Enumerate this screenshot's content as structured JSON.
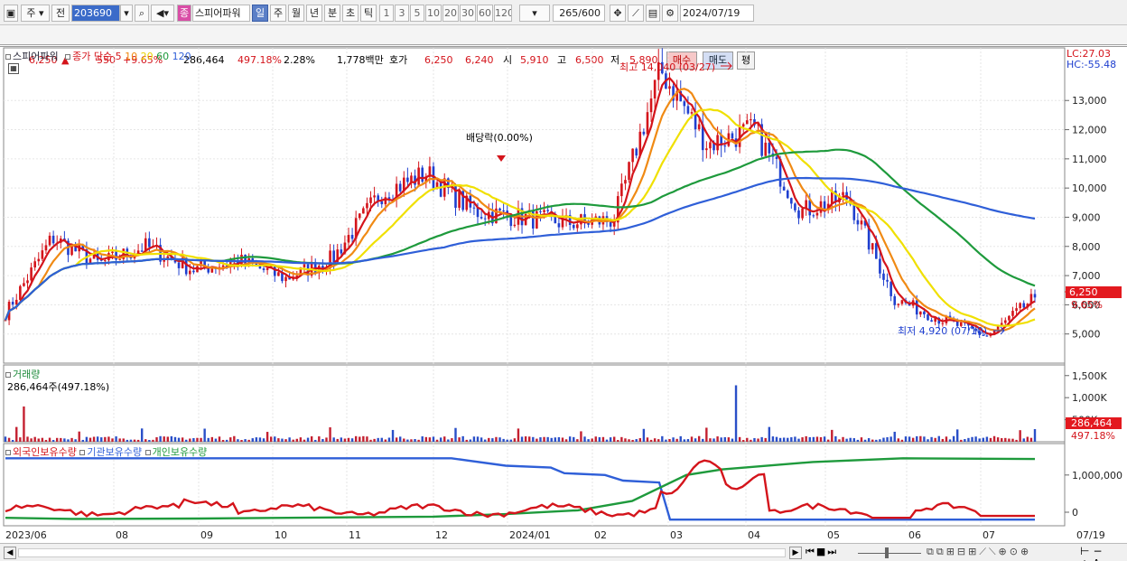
{
  "toolbar": {
    "type_label": "주",
    "prev_label": "전",
    "code": "203690",
    "name_badge": "종",
    "name": "스피어파워",
    "periods": [
      "일",
      "주",
      "월",
      "년",
      "분",
      "초",
      "틱"
    ],
    "intervals": [
      "1",
      "3",
      "5",
      "10",
      "20",
      "30",
      "60",
      "120"
    ],
    "bar_count": "265",
    "bar_total": "/600",
    "date": "2024/07/19"
  },
  "quote": {
    "price": "6,250",
    "arrow": "▲",
    "change": "550",
    "change_pct": "+9.65%",
    "volume": "286,464",
    "volume_pct": "497.18%",
    "turnover_pct": "2.28%",
    "amount": "1,778백만",
    "hoga_label": "호가",
    "ask": "6,250",
    "bid": "6,240",
    "open_label": "시",
    "open": "5,910",
    "high_label": "고",
    "high": "6,500",
    "low_label": "저",
    "low": "5,890",
    "buy_label": "매수",
    "sell_label": "매도",
    "avg_label": "평"
  },
  "price_panel": {
    "name": "스피어파워",
    "legend_title": "종가 단순",
    "ma": [
      {
        "period": "5",
        "color": "#d4141b"
      },
      {
        "period": "10",
        "color": "#f08a14"
      },
      {
        "period": "20",
        "color": "#f0e000"
      },
      {
        "period": "60",
        "color": "#1e9a3c"
      },
      {
        "period": "120",
        "color": "#2f5fd8"
      }
    ],
    "lc": "LC:27.03",
    "hc": "HC:-55.48",
    "y_ticks": [
      "13,000",
      "12,000",
      "11,000",
      "10,000",
      "9,000",
      "8,000",
      "7,000",
      "6,000",
      "5,000"
    ],
    "high_note": "최고 14,040 (03/27)",
    "low_note": "최저 4,920 (07/10)",
    "dividend_note": "배당락(0.00%)",
    "current_price": "6,250",
    "current_pct": "9.65%"
  },
  "volume_panel": {
    "title": "거래량",
    "value": "286,464주(497.18%)",
    "y_ticks": [
      "1,500K",
      "1,000K",
      "500K"
    ],
    "current": "286,464",
    "current_pct": "497.18%"
  },
  "holding_panel": {
    "legend": [
      {
        "label": "외국인보유수량",
        "color": "#d4141b"
      },
      {
        "label": "기관보유수량",
        "color": "#2f5fd8"
      },
      {
        "label": "개인보유수량",
        "color": "#1e9a3c"
      }
    ],
    "y_ticks": [
      "1,000,000",
      "0"
    ]
  },
  "x_axis": [
    "2023/06",
    "08",
    "09",
    "10",
    "11",
    "12",
    "2024/01",
    "02",
    "03",
    "04",
    "05",
    "06",
    "07",
    "07/19"
  ],
  "chart_data": {
    "type": "candlestick",
    "title": "스피어파워",
    "dates": [
      "2023/06",
      "08",
      "09",
      "10",
      "11",
      "12",
      "2024/01",
      "02",
      "03",
      "04",
      "05",
      "06",
      "07",
      "07/19"
    ],
    "close": [
      5700,
      8300,
      7400,
      8000,
      7200,
      7500,
      6900,
      7600,
      9800,
      10500,
      9200,
      9000,
      8800,
      8900,
      14040,
      11500,
      12000,
      9200,
      9700,
      6200,
      5500,
      4920,
      6250
    ],
    "ylim": [
      4000,
      14400
    ],
    "annotations": [
      "최고 14,040 (03/27)",
      "최저 4,920 (07/10)",
      "배당락(0.00%)"
    ]
  }
}
